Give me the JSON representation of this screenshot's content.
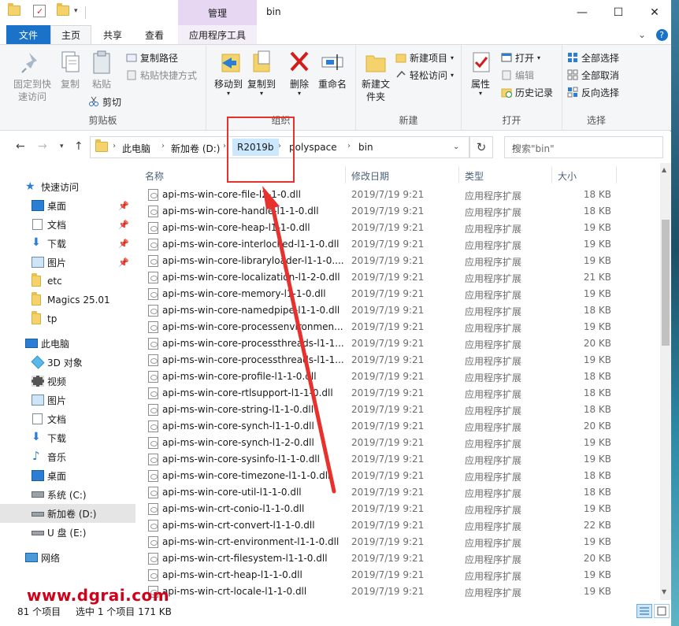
{
  "titlebar": {
    "context_tab_label": "管理",
    "window_title": "bin",
    "minimize": "—",
    "maximize": "☐",
    "close": "✕"
  },
  "tabs": {
    "file": "文件",
    "home": "主页",
    "share": "共享",
    "view": "查看",
    "app_tools": "应用程序工具",
    "expand": "⌄",
    "help": "?"
  },
  "ribbon": {
    "clipboard": {
      "label": "剪贴板",
      "pin_quick_access": "固定到快速访问",
      "copy": "复制",
      "paste": "粘贴",
      "copy_path": "复制路径",
      "paste_shortcut": "粘贴快捷方式",
      "cut": "剪切"
    },
    "organize": {
      "label": "组织",
      "move_to": "移动到",
      "copy_to": "复制到",
      "delete": "删除",
      "rename": "重命名"
    },
    "new": {
      "label": "新建",
      "new_folder": "新建文件夹",
      "new_item": "新建项目",
      "easy_access": "轻松访问"
    },
    "open": {
      "label": "打开",
      "properties": "属性",
      "open": "打开",
      "edit": "编辑",
      "history": "历史记录"
    },
    "select": {
      "label": "选择",
      "select_all": "全部选择",
      "select_none": "全部取消",
      "invert": "反向选择"
    }
  },
  "address": {
    "crumbs": [
      "此电脑",
      "新加卷 (D:)",
      "R2019b",
      "polyspace",
      "bin"
    ],
    "search_placeholder": "搜索\"bin\""
  },
  "nav": {
    "quick_access": "快速访问",
    "desktop": "桌面",
    "documents": "文档",
    "downloads": "下载",
    "pictures": "图片",
    "etc": "etc",
    "magics": "Magics 25.01",
    "tp": "tp",
    "this_pc": "此电脑",
    "objects3d": "3D 对象",
    "videos": "视频",
    "pictures2": "图片",
    "documents2": "文档",
    "downloads2": "下载",
    "music": "音乐",
    "desktop2": "桌面",
    "drive_c": "系统 (C:)",
    "drive_d": "新加卷 (D:)",
    "drive_e": "U 盘 (E:)",
    "network": "网络"
  },
  "columns": {
    "name": "名称",
    "date": "修改日期",
    "type": "类型",
    "size": "大小"
  },
  "files": [
    {
      "name": "api-ms-win-core-file-l2-1-0.dll",
      "date": "2019/7/19 9:21",
      "type": "应用程序扩展",
      "size": "18 KB"
    },
    {
      "name": "api-ms-win-core-handle-l1-1-0.dll",
      "date": "2019/7/19 9:21",
      "type": "应用程序扩展",
      "size": "18 KB"
    },
    {
      "name": "api-ms-win-core-heap-l1-1-0.dll",
      "date": "2019/7/19 9:21",
      "type": "应用程序扩展",
      "size": "19 KB"
    },
    {
      "name": "api-ms-win-core-interlocked-l1-1-0.dll",
      "date": "2019/7/19 9:21",
      "type": "应用程序扩展",
      "size": "19 KB"
    },
    {
      "name": "api-ms-win-core-libraryloader-l1-1-0....",
      "date": "2019/7/19 9:21",
      "type": "应用程序扩展",
      "size": "19 KB"
    },
    {
      "name": "api-ms-win-core-localization-l1-2-0.dll",
      "date": "2019/7/19 9:21",
      "type": "应用程序扩展",
      "size": "21 KB"
    },
    {
      "name": "api-ms-win-core-memory-l1-1-0.dll",
      "date": "2019/7/19 9:21",
      "type": "应用程序扩展",
      "size": "19 KB"
    },
    {
      "name": "api-ms-win-core-namedpipe-l1-1-0.dll",
      "date": "2019/7/19 9:21",
      "type": "应用程序扩展",
      "size": "18 KB"
    },
    {
      "name": "api-ms-win-core-processenvironmen...",
      "date": "2019/7/19 9:21",
      "type": "应用程序扩展",
      "size": "19 KB"
    },
    {
      "name": "api-ms-win-core-processthreads-l1-1...",
      "date": "2019/7/19 9:21",
      "type": "应用程序扩展",
      "size": "20 KB"
    },
    {
      "name": "api-ms-win-core-processthreads-l1-1...",
      "date": "2019/7/19 9:21",
      "type": "应用程序扩展",
      "size": "19 KB"
    },
    {
      "name": "api-ms-win-core-profile-l1-1-0.dll",
      "date": "2019/7/19 9:21",
      "type": "应用程序扩展",
      "size": "18 KB"
    },
    {
      "name": "api-ms-win-core-rtlsupport-l1-1-0.dll",
      "date": "2019/7/19 9:21",
      "type": "应用程序扩展",
      "size": "18 KB"
    },
    {
      "name": "api-ms-win-core-string-l1-1-0.dll",
      "date": "2019/7/19 9:21",
      "type": "应用程序扩展",
      "size": "18 KB"
    },
    {
      "name": "api-ms-win-core-synch-l1-1-0.dll",
      "date": "2019/7/19 9:21",
      "type": "应用程序扩展",
      "size": "20 KB"
    },
    {
      "name": "api-ms-win-core-synch-l1-2-0.dll",
      "date": "2019/7/19 9:21",
      "type": "应用程序扩展",
      "size": "19 KB"
    },
    {
      "name": "api-ms-win-core-sysinfo-l1-1-0.dll",
      "date": "2019/7/19 9:21",
      "type": "应用程序扩展",
      "size": "19 KB"
    },
    {
      "name": "api-ms-win-core-timezone-l1-1-0.dll",
      "date": "2019/7/19 9:21",
      "type": "应用程序扩展",
      "size": "18 KB"
    },
    {
      "name": "api-ms-win-core-util-l1-1-0.dll",
      "date": "2019/7/19 9:21",
      "type": "应用程序扩展",
      "size": "18 KB"
    },
    {
      "name": "api-ms-win-crt-conio-l1-1-0.dll",
      "date": "2019/7/19 9:21",
      "type": "应用程序扩展",
      "size": "19 KB"
    },
    {
      "name": "api-ms-win-crt-convert-l1-1-0.dll",
      "date": "2019/7/19 9:21",
      "type": "应用程序扩展",
      "size": "22 KB"
    },
    {
      "name": "api-ms-win-crt-environment-l1-1-0.dll",
      "date": "2019/7/19 9:21",
      "type": "应用程序扩展",
      "size": "19 KB"
    },
    {
      "name": "api-ms-win-crt-filesystem-l1-1-0.dll",
      "date": "2019/7/19 9:21",
      "type": "应用程序扩展",
      "size": "20 KB"
    },
    {
      "name": "api-ms-win-crt-heap-l1-1-0.dll",
      "date": "2019/7/19 9:21",
      "type": "应用程序扩展",
      "size": "19 KB"
    },
    {
      "name": "api-ms-win-crt-locale-l1-1-0.dll",
      "date": "2019/7/19 9:21",
      "type": "应用程序扩展",
      "size": "19 KB"
    }
  ],
  "status": {
    "count": "81 个项目",
    "selection": "选中 1 个项目  171 KB"
  },
  "watermark": "www.dgrai.com",
  "colors": {
    "file_tab": "#1a73c8",
    "context_tab": "#e7d7f3",
    "selected_crumb": "#cce8ff",
    "annotation": "#e8312d"
  }
}
